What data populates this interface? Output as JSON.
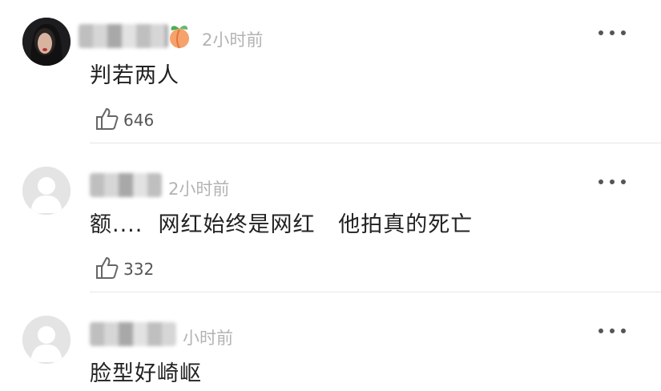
{
  "comments": [
    {
      "time": "2小时前",
      "text": "判若两人",
      "likes": "646"
    },
    {
      "time": "2小时前",
      "text": "额....  网红始终是网红   他拍真的死亡",
      "likes": "332"
    },
    {
      "time": "小时前",
      "text": "脸型好崎岖"
    }
  ]
}
